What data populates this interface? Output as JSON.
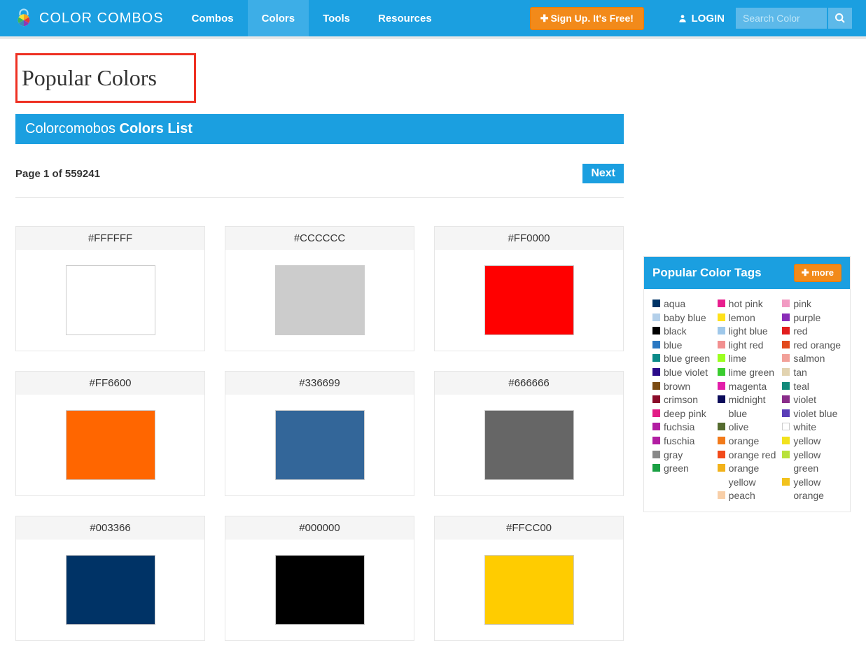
{
  "header": {
    "brand": "COLOR COMBOS",
    "nav": [
      {
        "label": "Combos",
        "active": false
      },
      {
        "label": "Colors",
        "active": true
      },
      {
        "label": "Tools",
        "active": false
      },
      {
        "label": "Resources",
        "active": false
      }
    ],
    "signup_label": "Sign Up. It's Free!",
    "login_label": "LOGIN",
    "search_placeholder": "Search Color"
  },
  "page": {
    "title": "Popular Colors",
    "list_header_light": "Colorcomobos ",
    "list_header_bold": "Colors List",
    "pager_info": "Page 1 of 559241",
    "next_label": "Next"
  },
  "colors": [
    {
      "hex": "#FFFFFF",
      "value": "#FFFFFF"
    },
    {
      "hex": "#CCCCCC",
      "value": "#CCCCCC"
    },
    {
      "hex": "#FF0000",
      "value": "#FF0000"
    },
    {
      "hex": "#FF6600",
      "value": "#FF6600"
    },
    {
      "hex": "#336699",
      "value": "#336699"
    },
    {
      "hex": "#666666",
      "value": "#666666"
    },
    {
      "hex": "#003366",
      "value": "#003366"
    },
    {
      "hex": "#000000",
      "value": "#000000"
    },
    {
      "hex": "#FFCC00",
      "value": "#FFCC00"
    }
  ],
  "tags_panel": {
    "title": "Popular Color Tags",
    "more_label": "more"
  },
  "tags": [
    {
      "name": "aqua",
      "chip": "#003366"
    },
    {
      "name": "baby blue",
      "chip": "#b4d0ea"
    },
    {
      "name": "black",
      "chip": "#000000"
    },
    {
      "name": "blue",
      "chip": "#2a78c2"
    },
    {
      "name": "blue green",
      "chip": "#0a8a88"
    },
    {
      "name": "blue violet",
      "chip": "#2b0b8a"
    },
    {
      "name": "brown",
      "chip": "#7a4a12"
    },
    {
      "name": "crimson",
      "chip": "#8a0b2a"
    },
    {
      "name": "deep pink",
      "chip": "#e21d86"
    },
    {
      "name": "fuchsia",
      "chip": "#b21da2"
    },
    {
      "name": "fuschia",
      "chip": "#b21da2"
    },
    {
      "name": "gray",
      "chip": "#888888"
    },
    {
      "name": "green",
      "chip": "#1aa043"
    },
    {
      "name": "hot pink",
      "chip": "#e81e8e"
    },
    {
      "name": "lemon",
      "chip": "#ffe11a"
    },
    {
      "name": "light blue",
      "chip": "#9fc8ea"
    },
    {
      "name": "light red",
      "chip": "#f29090"
    },
    {
      "name": "lime",
      "chip": "#9bff1f"
    },
    {
      "name": "lime green",
      "chip": "#3acc2f"
    },
    {
      "name": "magenta",
      "chip": "#e21da9"
    },
    {
      "name": "midnight blue",
      "chip": "#0b0b5a"
    },
    {
      "name": "olive",
      "chip": "#556b2f"
    },
    {
      "name": "orange",
      "chip": "#f27a1a"
    },
    {
      "name": "orange red",
      "chip": "#f24a1a"
    },
    {
      "name": "orange yellow",
      "chip": "#f2b21a"
    },
    {
      "name": "peach",
      "chip": "#f8cfa8"
    },
    {
      "name": "pink",
      "chip": "#f29bc3"
    },
    {
      "name": "purple",
      "chip": "#8a2db8"
    },
    {
      "name": "red",
      "chip": "#e21d1d"
    },
    {
      "name": "red orange",
      "chip": "#e24a1d"
    },
    {
      "name": "salmon",
      "chip": "#f2a099"
    },
    {
      "name": "tan",
      "chip": "#e2d3b0"
    },
    {
      "name": "teal",
      "chip": "#128a7a"
    },
    {
      "name": "violet",
      "chip": "#8a2d8a"
    },
    {
      "name": "violet blue",
      "chip": "#5a3db8"
    },
    {
      "name": "white",
      "chip": "#ffffff"
    },
    {
      "name": "yellow",
      "chip": "#f2e21d"
    },
    {
      "name": "yellow green",
      "chip": "#b8e23a"
    },
    {
      "name": "yellow orange",
      "chip": "#f2c21d"
    }
  ]
}
